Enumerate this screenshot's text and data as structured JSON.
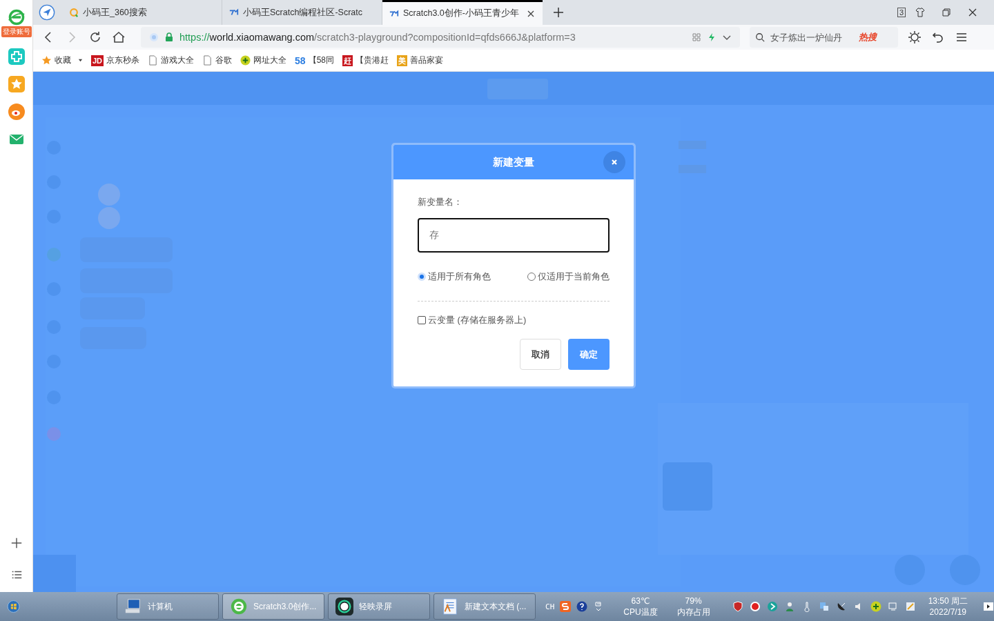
{
  "sidebar": {
    "login_label": "登录账号"
  },
  "tabs": [
    {
      "title": "小码王_360搜索",
      "kind": "search",
      "selected": false
    },
    {
      "title": "小码王Scratch编程社区-Scratc",
      "kind": "site",
      "selected": false
    },
    {
      "title": "Scratch3.0创作-小码王青少年",
      "kind": "site",
      "selected": true
    }
  ],
  "window_controls": {
    "tab_count": "3"
  },
  "address": {
    "scheme": "https://",
    "host": "world.xiaomawang.com",
    "path": "/scratch3-playground?compositionId=qfds666J&platform=3"
  },
  "search": {
    "placeholder": "女子炼出一炉仙丹",
    "badge": "热搜"
  },
  "bookmarks": [
    {
      "label": "收藏",
      "kind": "star"
    },
    {
      "label": "京东秒杀",
      "kind": "badge",
      "icon_text": "JD",
      "color": "#c8161d"
    },
    {
      "label": "游戏大全",
      "kind": "page"
    },
    {
      "label": "谷歌",
      "kind": "page"
    },
    {
      "label": "网址大全",
      "kind": "plus"
    },
    {
      "label": "【58同",
      "kind": "logo",
      "icon_text": "58",
      "color": "#2a7de1"
    },
    {
      "label": "【贵港赶",
      "kind": "badge",
      "icon_text": "赶",
      "color": "#c8161d"
    },
    {
      "label": "善品家宴",
      "kind": "badge",
      "icon_text": "美",
      "color": "#e8a317"
    }
  ],
  "dialog": {
    "title": "新建变量",
    "name_label": "新变量名：",
    "name_value": "存",
    "scopes": [
      {
        "label": "适用于所有角色",
        "selected": true
      },
      {
        "label": "仅适用于当前角色",
        "selected": false
      }
    ],
    "cloud": {
      "label": "云变量 (存储在服务器上)",
      "checked": false
    },
    "cancel": "取消",
    "ok": "确定"
  },
  "taskbar": {
    "items": [
      {
        "label": "计算机",
        "kind": "computer",
        "selected": false
      },
      {
        "label": "Scratch3.0创作...",
        "kind": "browser",
        "selected": true
      },
      {
        "label": "轻映录屏",
        "kind": "recorder",
        "selected": false
      },
      {
        "label": "新建文本文档 (...",
        "kind": "document",
        "selected": false
      }
    ],
    "ime": "CH",
    "cpu_value": "63℃",
    "cpu_label": "CPU温度",
    "mem_value": "79%",
    "mem_label": "内存占用",
    "time": "13:50 周二",
    "date": "2022/7/19"
  }
}
